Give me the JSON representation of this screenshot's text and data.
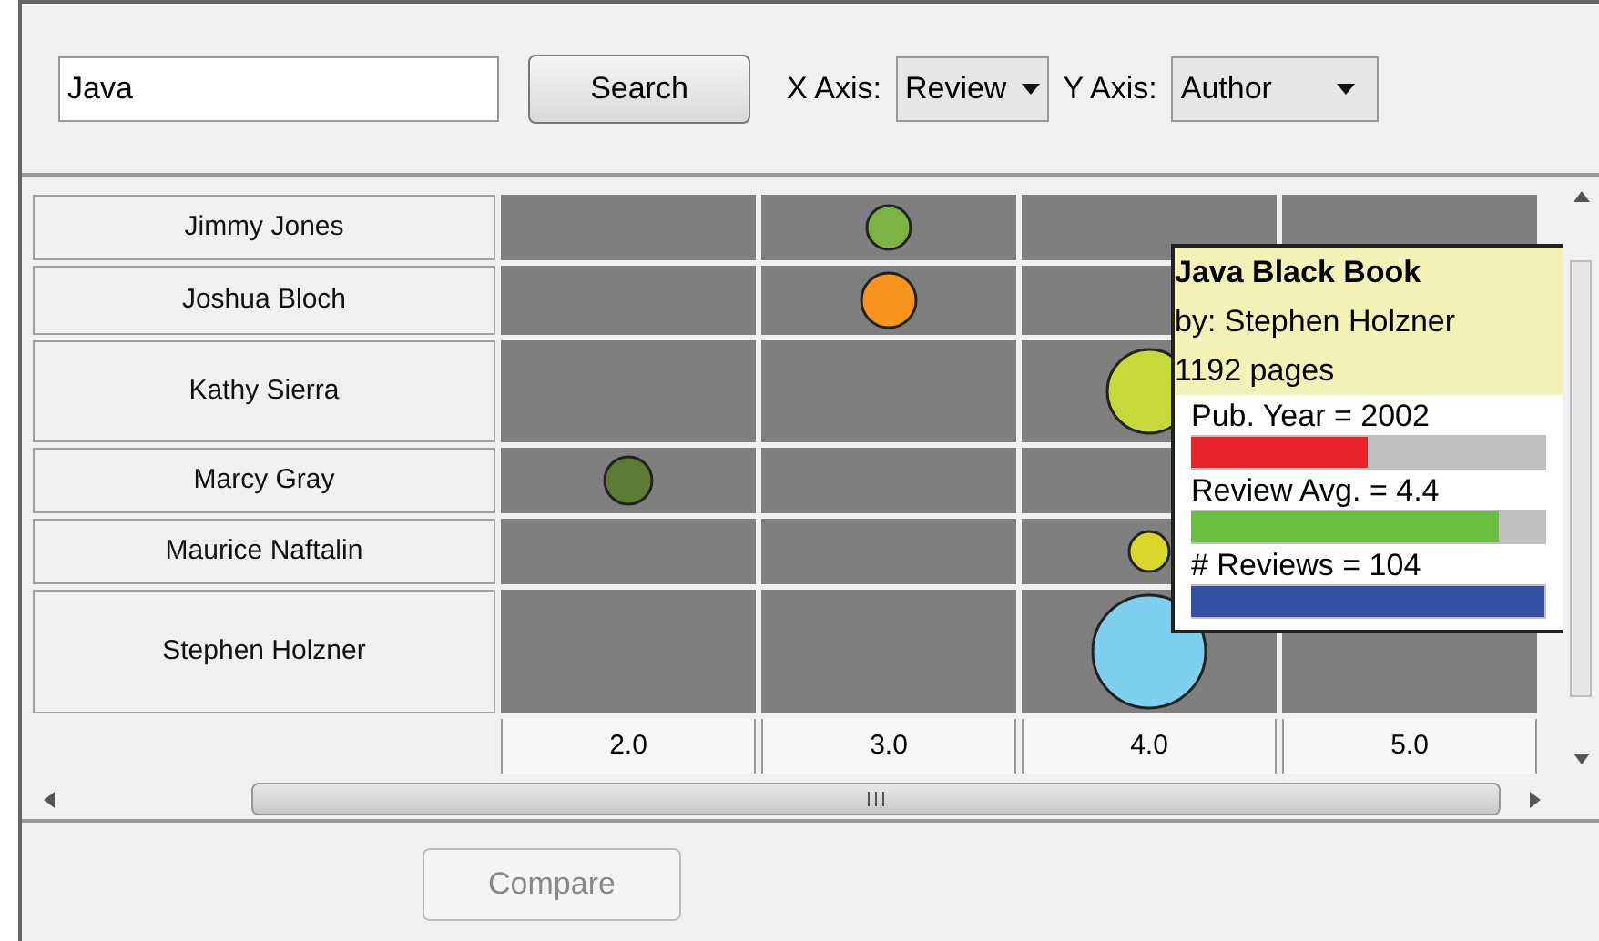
{
  "toolbar": {
    "search": {
      "value": "Java"
    },
    "search_button": "Search",
    "x_axis": {
      "label": "X Axis:",
      "value": "Review"
    },
    "y_axis": {
      "label": "Y Axis:",
      "value": "Author"
    }
  },
  "grid": {
    "columns": [
      "2.0",
      "3.0",
      "4.0",
      "5.0"
    ],
    "rows": [
      {
        "author": "Jimmy Jones",
        "cells": [
          {
            "bubble": false
          },
          {
            "bubble": true,
            "color": "#7cb342"
          },
          {
            "bubble": false
          },
          {
            "bubble": false
          }
        ]
      },
      {
        "author": "Joshua Bloch",
        "cells": [
          {
            "bubble": false
          },
          {
            "bubble": true,
            "color": "#f7931e"
          },
          {
            "bubble": false
          },
          {}
        ]
      },
      {
        "author": "Kathy Sierra",
        "cells": [
          {
            "bubble": false
          },
          {
            "bubble": false
          },
          {
            "bubble": true,
            "color": "#c5d93a"
          },
          {}
        ]
      },
      {
        "author": "Marcy Gray",
        "cells": [
          {
            "bubble": true,
            "color": "#5b7a34"
          },
          {
            "bubble": false
          },
          {
            "bubble": false
          },
          {}
        ]
      },
      {
        "author": "Maurice Naftalin",
        "cells": [
          {
            "bubble": false
          },
          {
            "bubble": false
          },
          {
            "bubble": true,
            "color": "#d9d52a"
          },
          {}
        ]
      },
      {
        "author": "Stephen Holzner",
        "cells": [
          {
            "bubble": false
          },
          {
            "bubble": false
          },
          {
            "bubble": true,
            "color": "#7fd0ee"
          },
          {
            "bubble": false
          }
        ]
      }
    ]
  },
  "tooltip": {
    "title": "Java Black Book",
    "author": "by: Stephen Holzner",
    "pages": "1192 pages",
    "metrics": [
      {
        "label": "Pub. Year = 2002",
        "level": 0.5,
        "color": "#e8232a"
      },
      {
        "label": "Review Avg. = 4.4",
        "level": 0.87,
        "color": "#6abf40"
      },
      {
        "label": "# Reviews = 104",
        "level": 1,
        "color": "#3450a3"
      }
    ]
  },
  "compare_button": {
    "label": "Compare",
    "disabled": true
  }
}
